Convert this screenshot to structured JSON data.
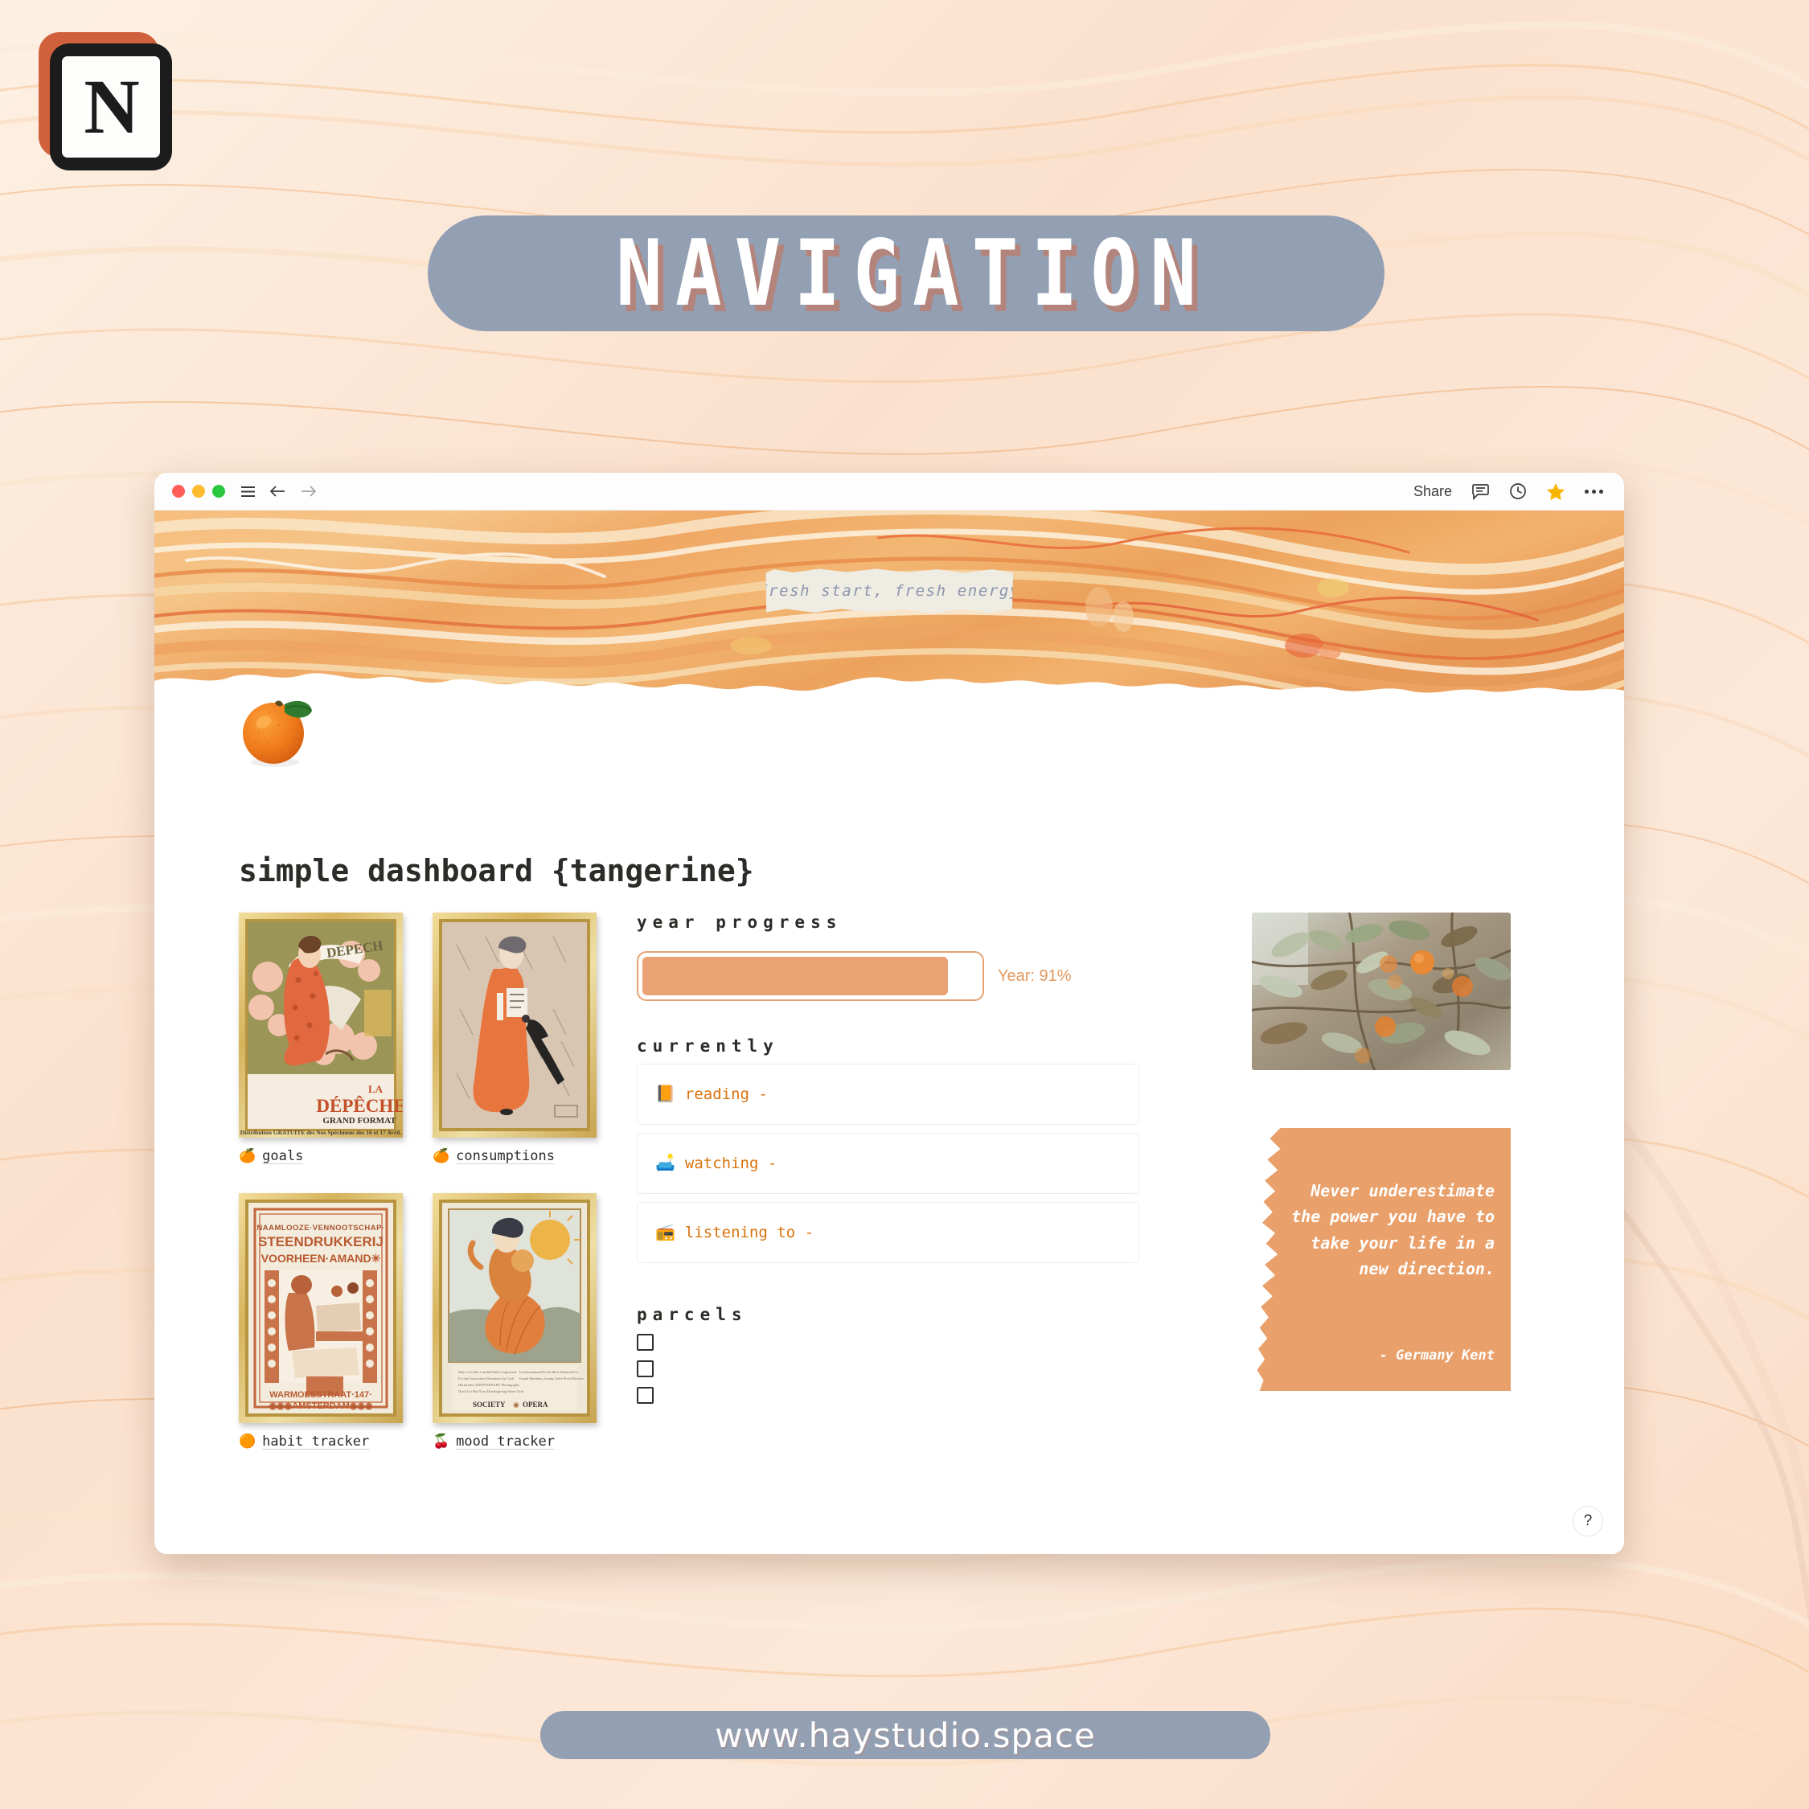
{
  "branding": {
    "logo_letter": "N",
    "logo_name": "notion-logo",
    "banner_title": "NAVIGATION",
    "footer_url": "www.haystudio.space",
    "accent_orange": "#d9730d",
    "accent_peach": "#e8a273",
    "slate": "#93a0b4"
  },
  "browser": {
    "share_label": "Share",
    "icons": [
      "menu-icon",
      "back-arrow-icon",
      "forward-arrow-icon",
      "comment-icon",
      "history-clock-icon",
      "favorite-star-icon",
      "more-options-icon"
    ]
  },
  "cover": {
    "tape_text": "fresh start, fresh energy"
  },
  "page": {
    "title": "simple dashboard {tangerine}",
    "help_label": "?"
  },
  "posters": [
    {
      "emoji": "🍊",
      "label": "goals",
      "art": "la-depeche"
    },
    {
      "emoji": "🍊",
      "label": "consumptions",
      "art": "woman-umbrella"
    },
    {
      "emoji": "🟠",
      "label": "habit tracker",
      "art": "steendrukkerij"
    },
    {
      "emoji": "🍒",
      "label": "mood tracker",
      "art": "dancer-fan"
    }
  ],
  "year_progress": {
    "heading": "year progress",
    "percent": 91,
    "label": "Year: 91%"
  },
  "currently": {
    "heading": "currently",
    "items": [
      {
        "emoji": "📙",
        "text": "reading -"
      },
      {
        "emoji": "🛋️",
        "text": "watching -"
      },
      {
        "emoji": "📻",
        "text": "listening to -"
      }
    ]
  },
  "parcels": {
    "heading": "parcels",
    "items": [
      {
        "checked": false,
        "text": ""
      },
      {
        "checked": false,
        "text": ""
      },
      {
        "checked": false,
        "text": ""
      }
    ]
  },
  "quote": {
    "text": "Never underestimate the power you have to take your life in a new direction.",
    "author": "- Germany Kent"
  },
  "photo": {
    "alt": "persimmon-tree-photo"
  }
}
